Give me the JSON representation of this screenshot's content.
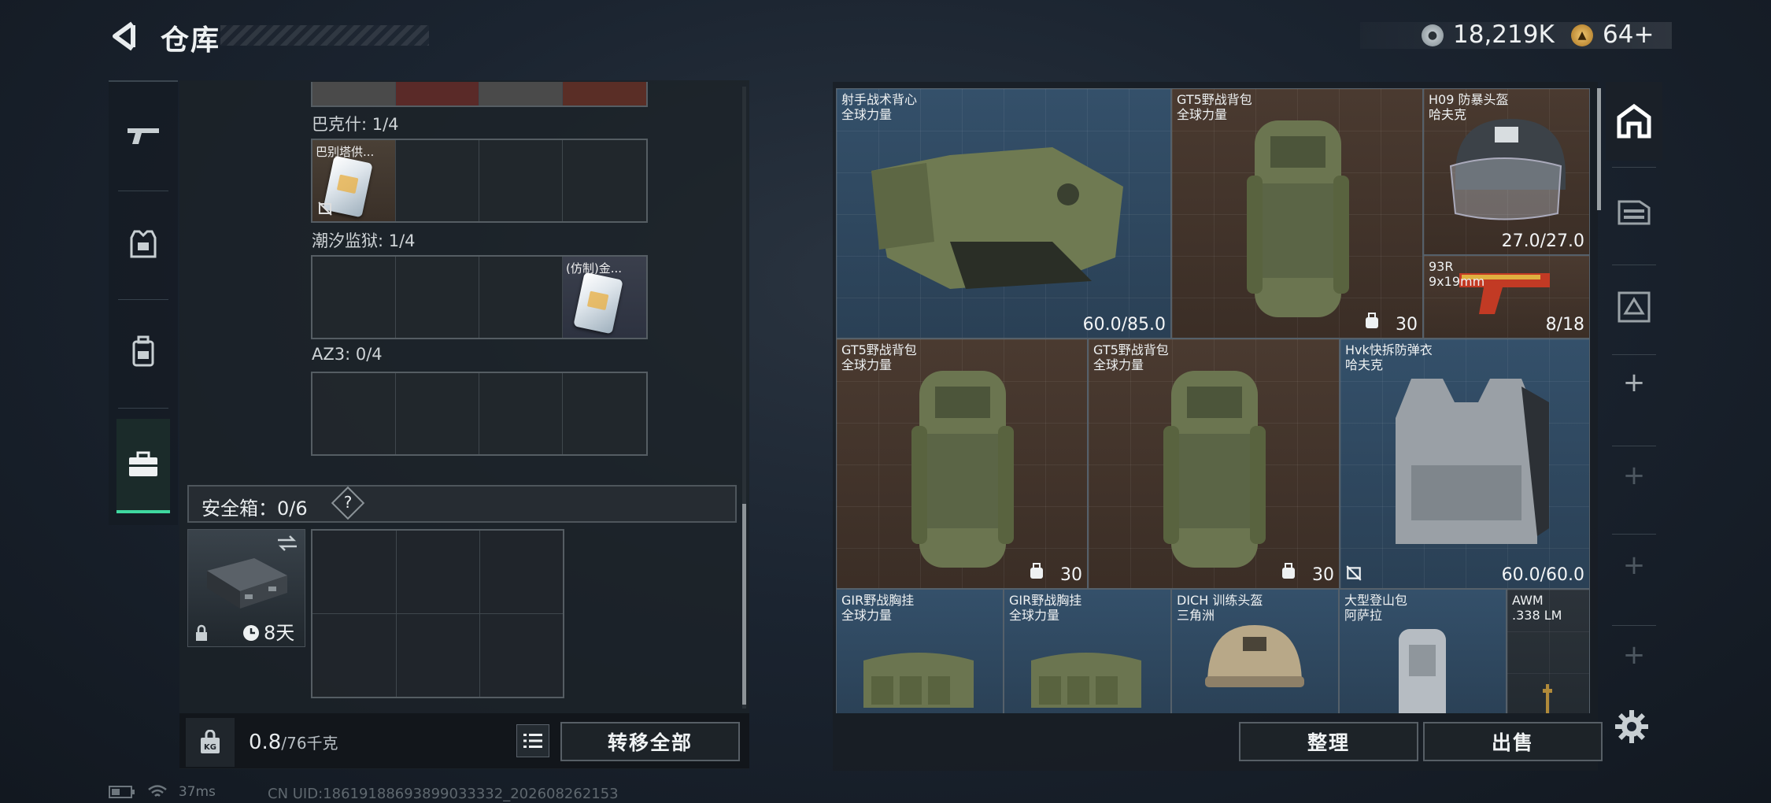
{
  "header": {
    "title": "仓库",
    "money": "18,219K",
    "tokens": "64+"
  },
  "left_nav": {
    "items": [
      {
        "icon": "gun-icon"
      },
      {
        "icon": "armor-icon"
      },
      {
        "icon": "backpack-icon"
      },
      {
        "icon": "briefcase-icon",
        "active": true
      }
    ]
  },
  "keycard_groups": [
    {
      "label": "巴克什: 1/4",
      "item": "巴别塔供..."
    },
    {
      "label": "潮汐监狱: 1/4",
      "item": "(仿制)金..."
    },
    {
      "label": "AZ3: 0/4",
      "item": ""
    }
  ],
  "safe_box": {
    "label": "安全箱：0/6",
    "help": "?",
    "timer": "8天"
  },
  "bottom_left": {
    "weight_value": "0.8",
    "weight_capacity": "/76千克",
    "transfer_all": "转移全部"
  },
  "inventory": [
    {
      "name": "射手战术背心",
      "brand": "全球力量",
      "stat": "60.0/85.0",
      "bg": "blue"
    },
    {
      "name": "GT5野战背包",
      "brand": "全球力量",
      "stat": "30",
      "bg": "brown"
    },
    {
      "name": "H09 防暴头盔",
      "brand": "哈夫克",
      "stat": "27.0/27.0",
      "bg": "brown"
    },
    {
      "name": "93R",
      "brand": "9x19mm",
      "stat": "8/18",
      "bg": "brown"
    },
    {
      "name": "GT5野战背包",
      "brand": "全球力量",
      "stat": "30",
      "bg": "brown"
    },
    {
      "name": "GT5野战背包",
      "brand": "全球力量",
      "stat": "30",
      "bg": "brown"
    },
    {
      "name": "Hvk快拆防弹衣",
      "brand": "哈夫克",
      "stat": "60.0/60.0",
      "bg": "blue"
    },
    {
      "name": "GIR野战胸挂",
      "brand": "全球力量",
      "stat": "",
      "bg": "blue"
    },
    {
      "name": "GIR野战胸挂",
      "brand": "全球力量",
      "stat": "",
      "bg": "blue"
    },
    {
      "name": "DICH 训练头盔",
      "brand": "三角洲",
      "stat": "",
      "bg": "blue"
    },
    {
      "name": "大型登山包",
      "brand": "阿萨拉",
      "stat": "",
      "bg": "blue"
    },
    {
      "name": "AWM",
      "brand": ".338 LM",
      "stat": "",
      "bg": "gray"
    }
  ],
  "right_nav": {
    "items": [
      {
        "icon": "home-stash-icon",
        "active": true
      },
      {
        "icon": "container-icon"
      },
      {
        "icon": "warehouse-icon"
      },
      {
        "icon": "plus-icon"
      },
      {
        "icon": "plus-icon"
      },
      {
        "icon": "plus-icon"
      },
      {
        "icon": "plus-icon"
      }
    ]
  },
  "actions": {
    "tidy": "整理",
    "sell": "出售"
  },
  "status": {
    "ping": "37ms",
    "uid": "CN UID:18619188693899033332_202608262153"
  },
  "colors": {
    "accent": "#3fd8a0",
    "slot_blue": "#34506a",
    "slot_brown": "#4a3a30"
  }
}
